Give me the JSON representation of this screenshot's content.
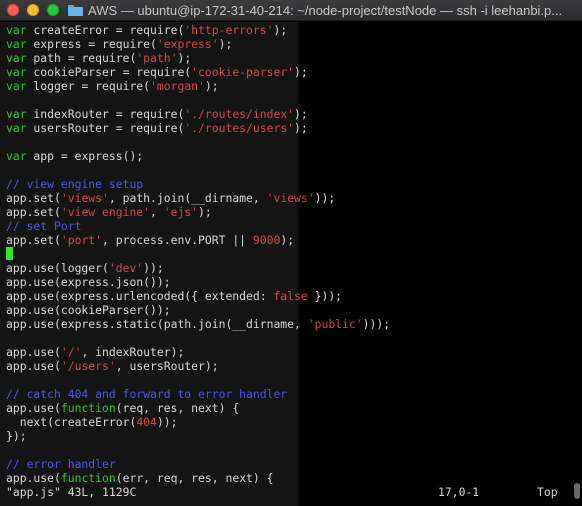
{
  "window": {
    "title": "AWS — ubuntu@ip-172-31-40-214: ~/node-project/testNode — ssh -i leehanbi.p..."
  },
  "editor": {
    "lines": [
      [
        {
          "t": "var",
          "c": "kw"
        },
        {
          "t": " createError = require("
        },
        {
          "t": "'http-errors'",
          "c": "str"
        },
        {
          "t": ");"
        }
      ],
      [
        {
          "t": "var",
          "c": "kw"
        },
        {
          "t": " express = require("
        },
        {
          "t": "'express'",
          "c": "str"
        },
        {
          "t": ");"
        }
      ],
      [
        {
          "t": "var",
          "c": "kw"
        },
        {
          "t": " path = require("
        },
        {
          "t": "'path'",
          "c": "str"
        },
        {
          "t": ");"
        }
      ],
      [
        {
          "t": "var",
          "c": "kw"
        },
        {
          "t": " cookieParser = require("
        },
        {
          "t": "'cookie-parser'",
          "c": "str"
        },
        {
          "t": ");"
        }
      ],
      [
        {
          "t": "var",
          "c": "kw"
        },
        {
          "t": " logger = require("
        },
        {
          "t": "'morgan'",
          "c": "str"
        },
        {
          "t": ");"
        }
      ],
      [],
      [
        {
          "t": "var",
          "c": "kw"
        },
        {
          "t": " indexRouter = require("
        },
        {
          "t": "'./routes/index'",
          "c": "str"
        },
        {
          "t": ");"
        }
      ],
      [
        {
          "t": "var",
          "c": "kw"
        },
        {
          "t": " usersRouter = require("
        },
        {
          "t": "'./routes/users'",
          "c": "str"
        },
        {
          "t": ");"
        }
      ],
      [],
      [
        {
          "t": "var",
          "c": "kw"
        },
        {
          "t": " app = express();"
        }
      ],
      [],
      [
        {
          "t": "// view engine setup",
          "c": "cm"
        }
      ],
      [
        {
          "t": "app.set("
        },
        {
          "t": "'views'",
          "c": "str"
        },
        {
          "t": ", path.join(__dirname, "
        },
        {
          "t": "'views'",
          "c": "str"
        },
        {
          "t": "));"
        }
      ],
      [
        {
          "t": "app.set("
        },
        {
          "t": "'view engine'",
          "c": "str"
        },
        {
          "t": ", "
        },
        {
          "t": "'ejs'",
          "c": "str"
        },
        {
          "t": ");"
        }
      ],
      [
        {
          "t": "// set Port",
          "c": "cm"
        }
      ],
      [
        {
          "t": "app.set("
        },
        {
          "t": "'port'",
          "c": "str"
        },
        {
          "t": ", process.env.PORT || "
        },
        {
          "t": "9000",
          "c": "str"
        },
        {
          "t": ");"
        }
      ],
      [
        {
          "t": "",
          "cursor": true
        }
      ],
      [
        {
          "t": "app.use(logger("
        },
        {
          "t": "'dev'",
          "c": "str"
        },
        {
          "t": "));"
        }
      ],
      [
        {
          "t": "app.use(express.json());"
        }
      ],
      [
        {
          "t": "app.use(express.urlencoded({ extended: "
        },
        {
          "t": "false",
          "c": "bool"
        },
        {
          "t": " }));"
        }
      ],
      [
        {
          "t": "app.use(cookieParser());"
        }
      ],
      [
        {
          "t": "app.use(express.static(path.join(__dirname, "
        },
        {
          "t": "'public'",
          "c": "str"
        },
        {
          "t": ")));"
        }
      ],
      [],
      [
        {
          "t": "app.use("
        },
        {
          "t": "'/'",
          "c": "str"
        },
        {
          "t": ", indexRouter);"
        }
      ],
      [
        {
          "t": "app.use("
        },
        {
          "t": "'/users'",
          "c": "str"
        },
        {
          "t": ", usersRouter);"
        }
      ],
      [],
      [
        {
          "t": "// catch 404 and forward to error handler",
          "c": "cm"
        }
      ],
      [
        {
          "t": "app.use("
        },
        {
          "t": "function",
          "c": "kw"
        },
        {
          "t": "(req, res, next) {"
        }
      ],
      [
        {
          "t": "  next(createError("
        },
        {
          "t": "404",
          "c": "str"
        },
        {
          "t": "));"
        }
      ],
      [
        {
          "t": "});"
        }
      ],
      [],
      [
        {
          "t": "// error handler",
          "c": "cm"
        }
      ],
      [
        {
          "t": "app.use("
        },
        {
          "t": "function",
          "c": "kw"
        },
        {
          "t": "(err, req, res, next) {"
        }
      ]
    ]
  },
  "status": {
    "file": "\"app.js\" 43L, 1129C",
    "position": "17,0-1",
    "scroll": "Top"
  }
}
